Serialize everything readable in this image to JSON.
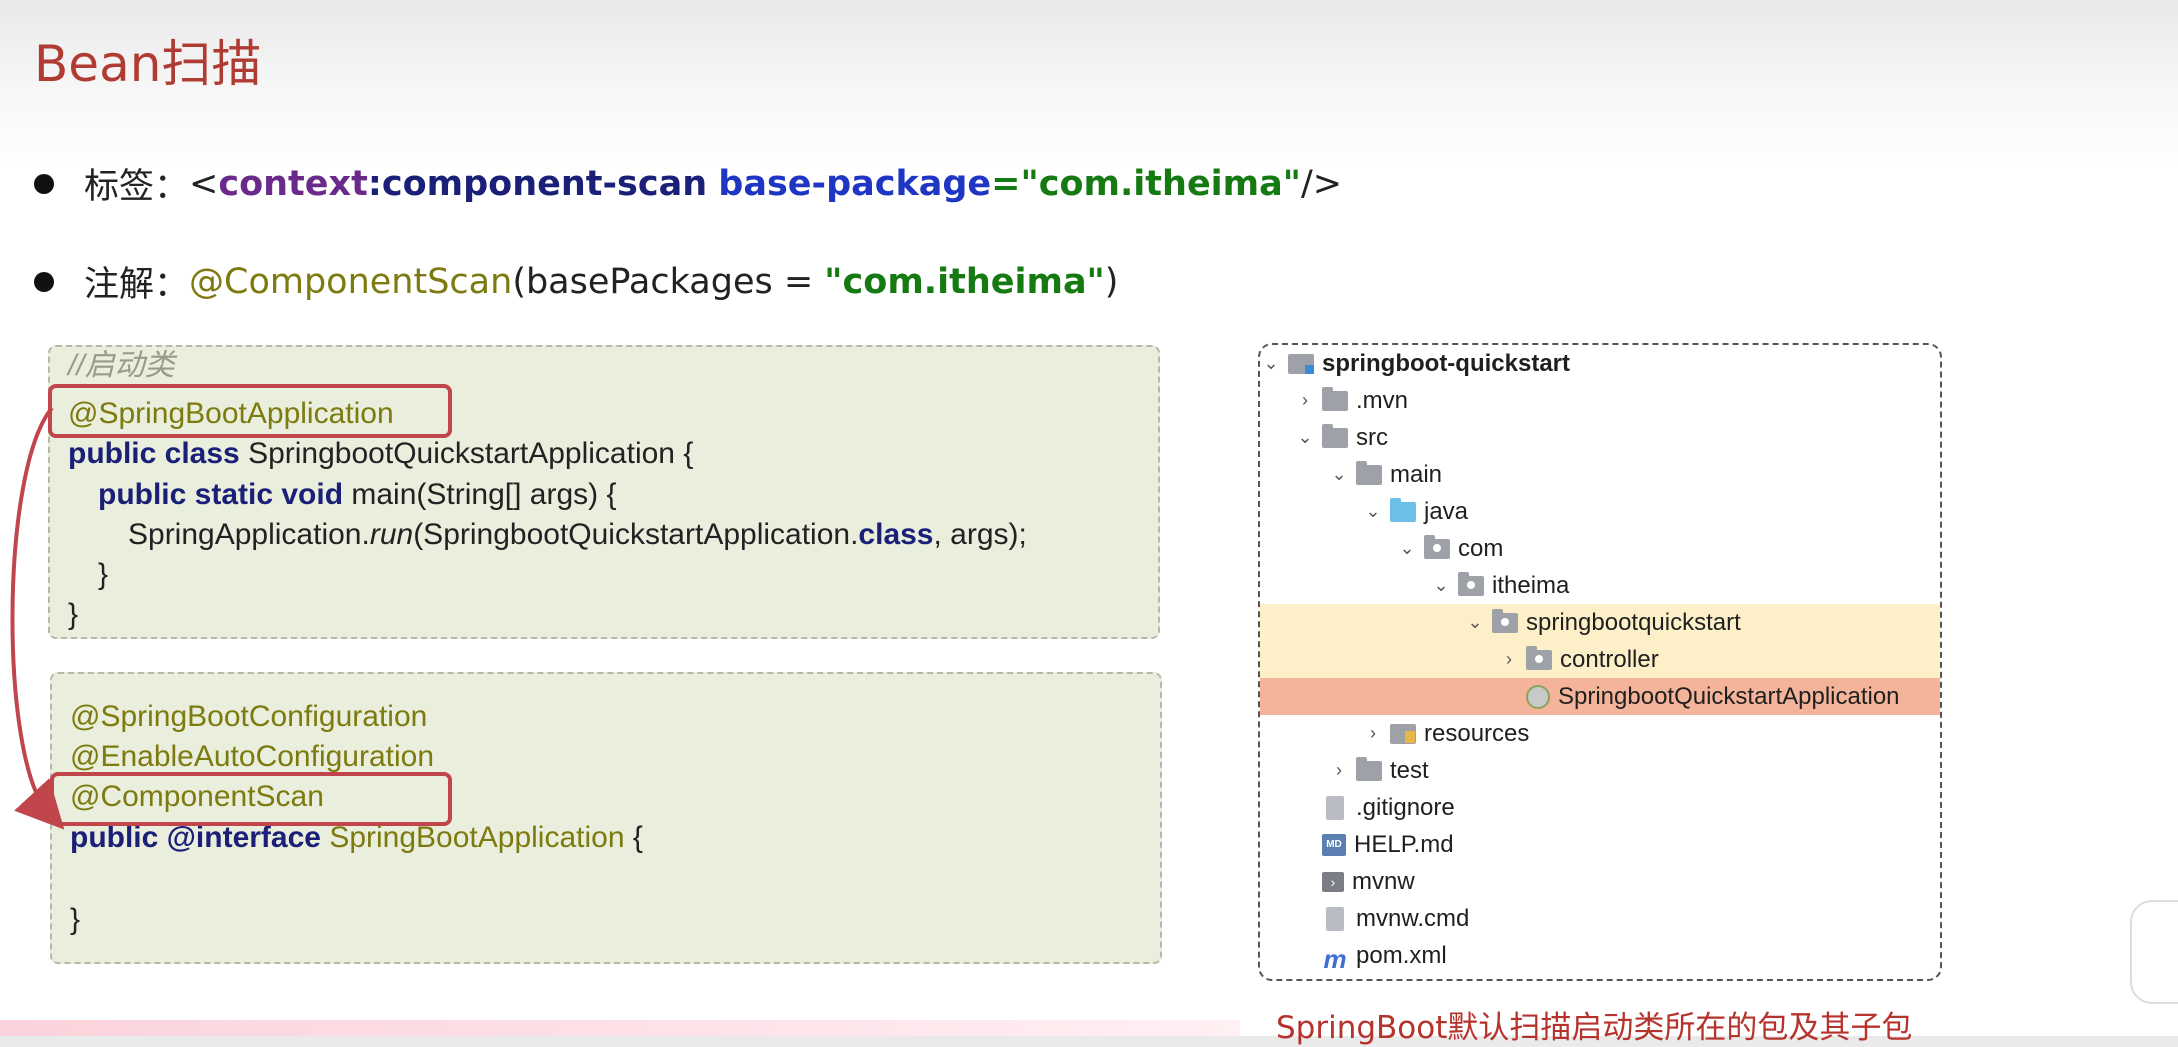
{
  "title": "Bean扫描",
  "bullet1": {
    "label": "标签：",
    "lt": "<",
    "ns": "context",
    "colon": ":",
    "tag": "component-scan",
    "attr": "base-package",
    "eq": "=",
    "value": "\"com.itheima\"",
    "close": "/>"
  },
  "bullet2": {
    "label": "注解：",
    "annotation": "@ComponentScan",
    "open": "(basePackages = ",
    "value": "\"com.itheima\"",
    "close": ")"
  },
  "code1": {
    "comment": "//启动类",
    "l1_ann": "@SpringBootApplication",
    "l2_kw": "public class",
    "l2_rest": " SpringbootQuickstartApplication {",
    "l3_kw": "public static void",
    "l3_rest": " main(String[] args) {",
    "l4_a": "SpringApplication.",
    "l4_run": "run",
    "l4_b": "(SpringbootQuickstartApplication.",
    "l4_kw": "class",
    "l4_c": ", args);",
    "l5": "}",
    "l6": "}"
  },
  "code2": {
    "l1": "@SpringBootConfiguration",
    "l2": "@EnableAutoConfiguration",
    "l3": "@ComponentScan",
    "l4_kw": "public @interface",
    "l4_name": " SpringBootApplication",
    "l4_rest": " {",
    "l5": "}"
  },
  "tree": {
    "items": [
      {
        "name": "springboot-quickstart"
      },
      {
        "name": ".mvn"
      },
      {
        "name": "src"
      },
      {
        "name": "main"
      },
      {
        "name": "java"
      },
      {
        "name": "com"
      },
      {
        "name": "itheima"
      },
      {
        "name": "springbootquickstart"
      },
      {
        "name": "controller"
      },
      {
        "name": "SpringbootQuickstartApplication"
      },
      {
        "name": "resources"
      },
      {
        "name": "test"
      },
      {
        "name": ".gitignore"
      },
      {
        "name": "HELP.md"
      },
      {
        "name": "mvnw"
      },
      {
        "name": "mvnw.cmd"
      },
      {
        "name": "pom.xml"
      }
    ]
  },
  "caption": "SpringBoot默认扫描启动类所在的包及其子包",
  "icons": {
    "chevron_right": "chevron-right-icon",
    "chevron_down": "chevron-down-icon",
    "folder": "folder-icon",
    "package": "package-icon",
    "spring_class": "spring-class-icon",
    "markdown": "markdown-icon",
    "maven": "maven-icon"
  },
  "colors": {
    "title": "#b03b33",
    "annotation": "#7d7a0f",
    "keyword": "#1a1f78",
    "string": "#157a12",
    "highlight_border": "#c0464c",
    "package_row": "#fdf0c8",
    "selected_row": "#f4b49a"
  }
}
